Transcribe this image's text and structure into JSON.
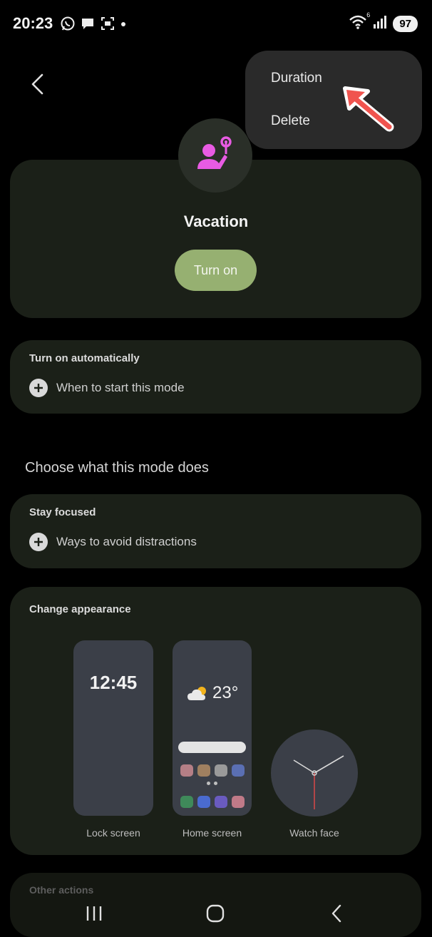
{
  "status_bar": {
    "time": "20:23",
    "battery": "97",
    "left_icons": [
      "whatsapp-icon",
      "chat-bubble-icon",
      "screenshot-icon",
      "dot-icon"
    ],
    "right_icons": [
      "wifi-icon",
      "signal-icon",
      "battery-icon"
    ],
    "wifi_badge": "6"
  },
  "header": {
    "back_icon": "chevron-left-icon"
  },
  "menu": {
    "items": [
      {
        "label": "Duration"
      },
      {
        "label": "Delete"
      }
    ],
    "annotation_color": "#f0544f"
  },
  "mode": {
    "title": "Vacation",
    "icon": "person-with-lollipop-icon",
    "icon_color": "#e85be3",
    "turn_on_label": "Turn on",
    "turn_on_color": "#96b071"
  },
  "auto": {
    "heading": "Turn on automatically",
    "row_label": "When to start this mode"
  },
  "section_title": "Choose what this mode does",
  "focus": {
    "heading": "Stay focused",
    "row_label": "Ways to avoid distractions"
  },
  "appearance": {
    "heading": "Change appearance",
    "lock_time": "12:45",
    "home_temp": "23°",
    "labels": {
      "lock": "Lock screen",
      "home": "Home screen",
      "watch": "Watch face"
    },
    "app_colors": [
      "#b57f86",
      "#a08060",
      "#9a9a9a",
      "#5a6fb3",
      "#3f8a5a",
      "#4a6bcf",
      "#6a5bc0",
      "#c07a88"
    ]
  },
  "other": {
    "heading": "Other actions"
  },
  "nav": {
    "icons": [
      "recents-icon",
      "home-icon",
      "back-icon"
    ]
  }
}
